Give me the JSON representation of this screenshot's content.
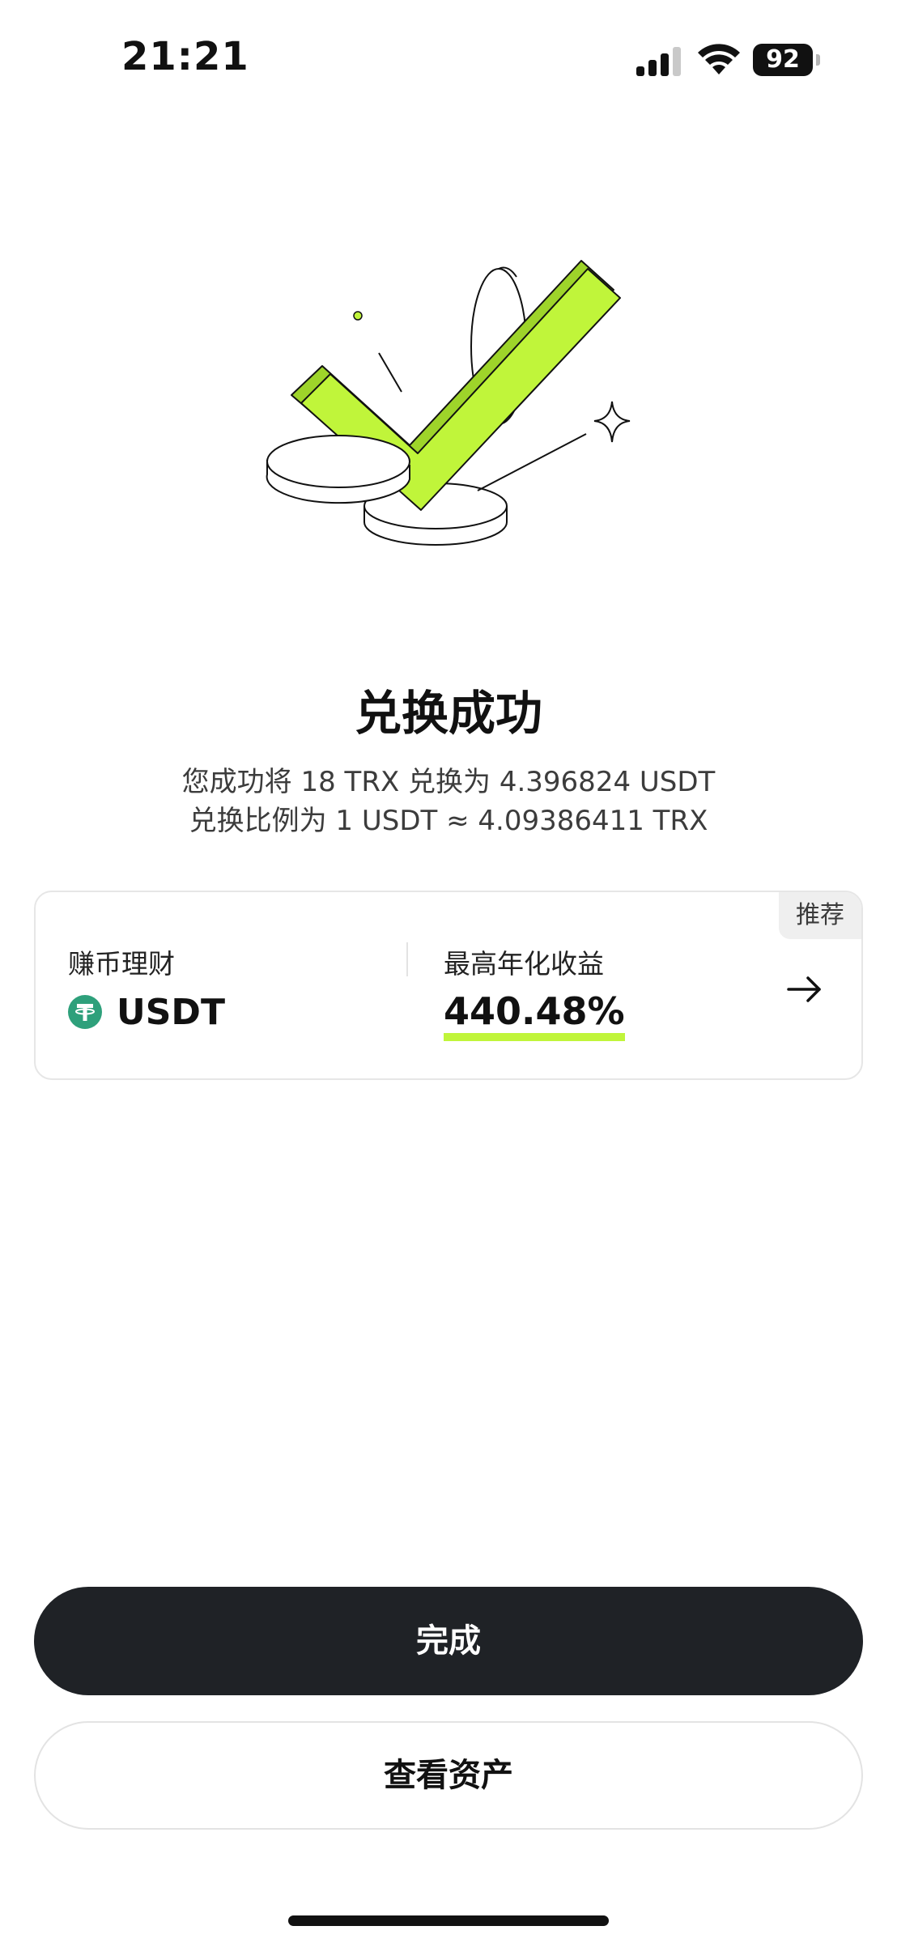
{
  "status_bar": {
    "time": "21:21",
    "battery": "92"
  },
  "result": {
    "title": "兑换成功",
    "line1": "您成功将 18 TRX 兑换为 4.396824 USDT",
    "line2": "兑换比例为 1 USDT ≈ 4.09386411 TRX"
  },
  "promo": {
    "badge": "推荐",
    "product_label": "赚币理财",
    "coin": "USDT",
    "coin_icon": "tether-icon",
    "yield_label": "最高年化收益",
    "yield_value": "440.48%",
    "accent_color": "#c0f53a"
  },
  "buttons": {
    "done": "完成",
    "view_assets": "查看资产"
  }
}
